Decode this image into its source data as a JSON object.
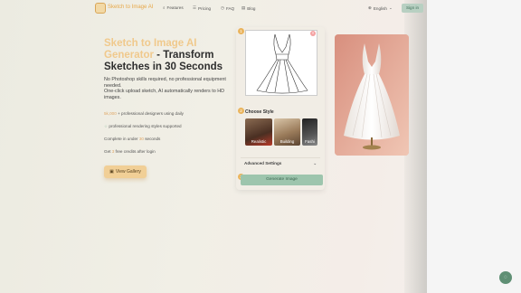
{
  "nav": {
    "brand": "Sketch to Image AI",
    "items": [
      {
        "label": "Features",
        "icon": "search-icon"
      },
      {
        "label": "Pricing",
        "icon": "list-icon"
      },
      {
        "label": "FAQ",
        "icon": "clock-icon"
      },
      {
        "label": "Blog",
        "icon": "document-icon"
      }
    ],
    "language": "English",
    "signin": "Sign in"
  },
  "hero": {
    "title_accent": "Sketch to Image AI Generator",
    "title_rest": " - Transform Sketches in 30 Seconds",
    "desc1": "No Photoshop skills required, no professional equipment needed.",
    "desc2": "One-click upload sketch, AI automatically renders to HD images.",
    "stat1_num": "5k,000",
    "stat1_text": "+ professional designers using daily",
    "stat2_sym": "☆",
    "stat2_text": "professional rendering styles supported",
    "stat3_pre": "Complete in under",
    "stat3_num": "30",
    "stat3_post": "seconds",
    "stat4_pre": "Get",
    "stat4_num": "3",
    "stat4_post": "free credits after login",
    "gallery_btn": "View Gallery"
  },
  "panel": {
    "step1": "1",
    "step2": "2",
    "step3": "3",
    "close": "×",
    "choose_style": "Choose Style",
    "styles": [
      "Realistic",
      "Building",
      "Fashi"
    ],
    "advanced": "Advanced Settings",
    "generate": "Generate Image"
  },
  "colors": {
    "accent": "#f0c98c",
    "primary_green": "#9dc5ad",
    "step": "#eab45c"
  }
}
